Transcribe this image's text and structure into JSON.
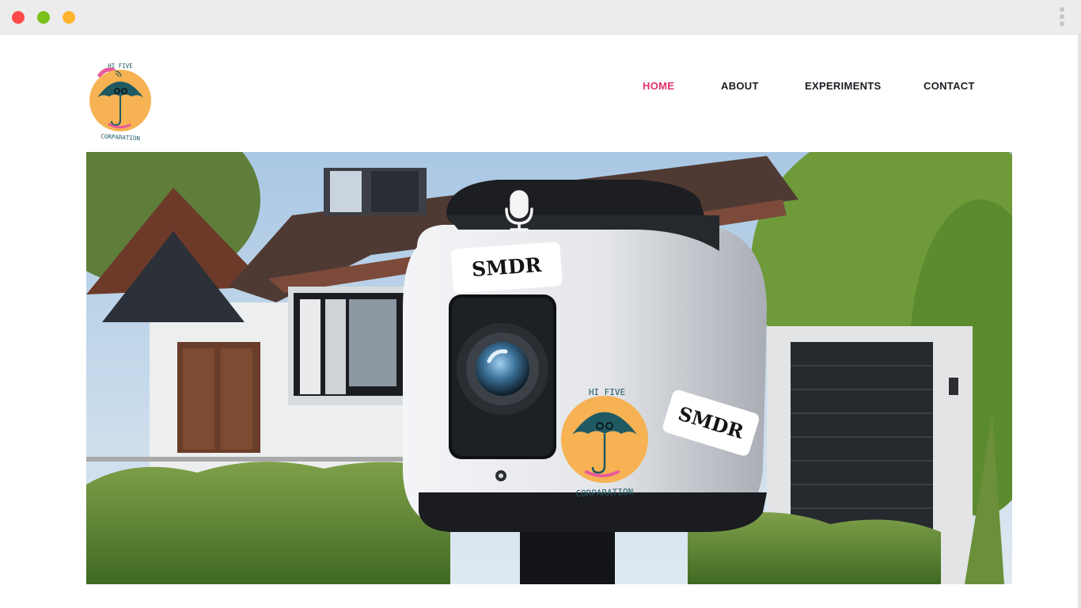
{
  "brand": {
    "name_top": "HI FIVE",
    "name_bottom": "CORPARATION",
    "logo_icon": "umbrella-logo-icon"
  },
  "nav": {
    "items": [
      {
        "label": "HOME",
        "active": true
      },
      {
        "label": "ABOUT",
        "active": false
      },
      {
        "label": "EXPERIMENTS",
        "active": false
      },
      {
        "label": "CONTACT",
        "active": false
      }
    ]
  },
  "hero": {
    "sticker_1": "SMDR",
    "sticker_2": "SMDR",
    "badge_top": "HI FIVE",
    "badge_bottom": "CORPARATION",
    "mic_icon": "microphone-icon",
    "camera_icon": "camera-lens-icon"
  },
  "colors": {
    "accent": "#e0306f",
    "nav_text": "#1d1d24",
    "logo_orange": "#f6b253",
    "logo_teal": "#1f5a62",
    "logo_pink": "#e85a9a"
  }
}
